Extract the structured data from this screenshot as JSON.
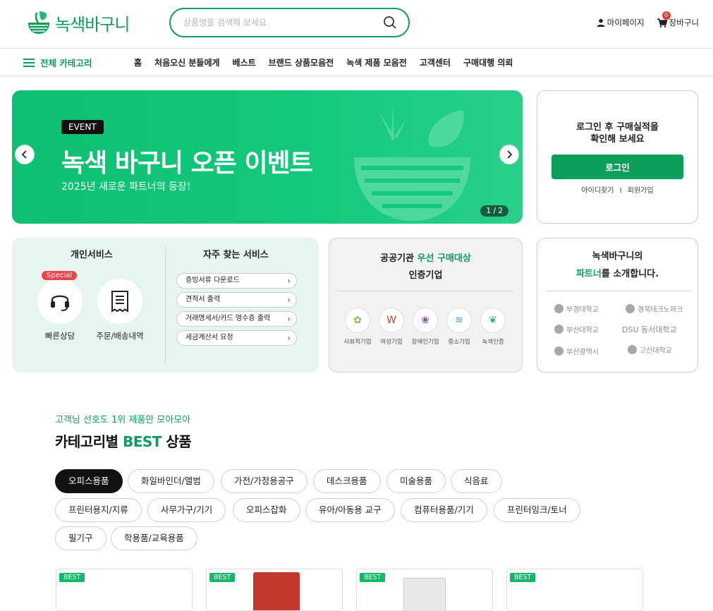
{
  "header": {
    "logo_text": "녹색바구니",
    "search_placeholder": "상품명을 검색해 보세요",
    "mypage": "마이페이지",
    "cart": "장바구니",
    "cart_count": "0"
  },
  "nav": {
    "all_category": "전체 카테고리",
    "items": [
      "홈",
      "처음오신 분들에게",
      "베스트",
      "브랜드 상품모음전",
      "녹색 제품 모음전",
      "고객센터",
      "구매대행 의뢰"
    ]
  },
  "banner": {
    "badge": "EVENT",
    "title": "녹색 바구니 오픈 이벤트",
    "subtitle": "2025년 새로운 파트너의 등장!",
    "pager": "1 / 2"
  },
  "login": {
    "message_line1": "로그인 후 구매실적을",
    "message_line2": "확인해 보세요",
    "button": "로그인",
    "find_id": "아이디찾기",
    "separator": "I",
    "signup": "회원가입"
  },
  "services": {
    "personal_title": "개인서비스",
    "special_badge": "Special",
    "consult_label": "빠른상담",
    "orders_label": "주문/배송내역",
    "quick_title": "자주 찾는 서비스",
    "quick_items": [
      "증빙서류 다운로드",
      "견적서 출력",
      "거래명세서/카드 영수증 출력",
      "세금계산서 요청"
    ]
  },
  "certified": {
    "title_pre": "공공기관 ",
    "title_green": "우선 구매대상",
    "title_line2": "인증기업",
    "items": [
      "사회적기업",
      "여성기업",
      "장애인기업",
      "중소기업",
      "녹색인증"
    ]
  },
  "partners": {
    "title_line1": "녹색바구니의",
    "title_green": "파트너",
    "title_rest": "를 소개합니다.",
    "logos": [
      "부경대학교",
      "경북테크노파크",
      "부산대학교",
      "DSU 동서대학교",
      "부산광역시",
      "고신대학교"
    ]
  },
  "best": {
    "subtitle": "고객님 선호도 1위 제품만 모아모아",
    "title_pre": "카테고리별 ",
    "title_green": "BEST",
    "title_post": " 상품",
    "chips": [
      "오피스용품",
      "화일바인더/앨범",
      "가전/가정용공구",
      "데스크용품",
      "미술용품",
      "식음료",
      "프린터용지/지류",
      "사무가구/기기",
      "오피스잡화",
      "유아/아동용 교구",
      "컴퓨터용품/기기",
      "프린터잉크/토너",
      "필기구",
      "학용품/교육용품"
    ],
    "product_tag": "BEST"
  },
  "colors": {
    "brand": "#0d9e5b",
    "banner": "#13c97c",
    "badge_red": "#e53935"
  }
}
